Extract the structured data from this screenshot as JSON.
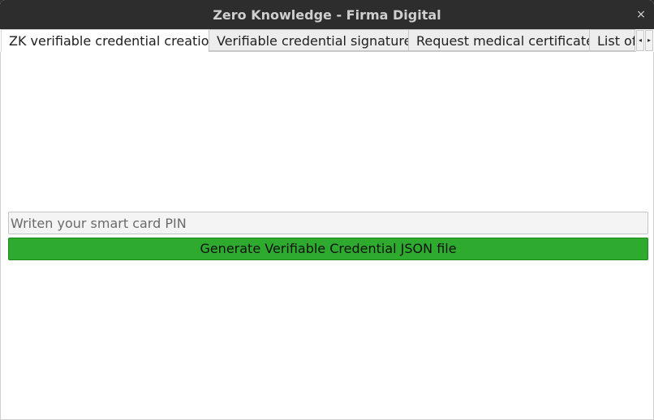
{
  "window": {
    "title": "Zero Knowledge - Firma Digital",
    "close_glyph": "×"
  },
  "tabs": [
    {
      "label": "ZK verifiable credential creation",
      "active": true
    },
    {
      "label": "Verifiable credential signature",
      "active": false
    },
    {
      "label": "Request medical certificate",
      "active": false
    },
    {
      "label": "List of",
      "active": false
    }
  ],
  "tab_scroll": {
    "left_glyph": "◂",
    "right_glyph": "▸"
  },
  "form": {
    "pin_placeholder": "Writen your smart card PIN",
    "pin_value": "",
    "generate_label": "Generate Verifiable Credential JSON file"
  },
  "colors": {
    "titlebar": "#2d2d2d",
    "generate_button": "#2eaa2e",
    "content_background": "#ffffff"
  }
}
